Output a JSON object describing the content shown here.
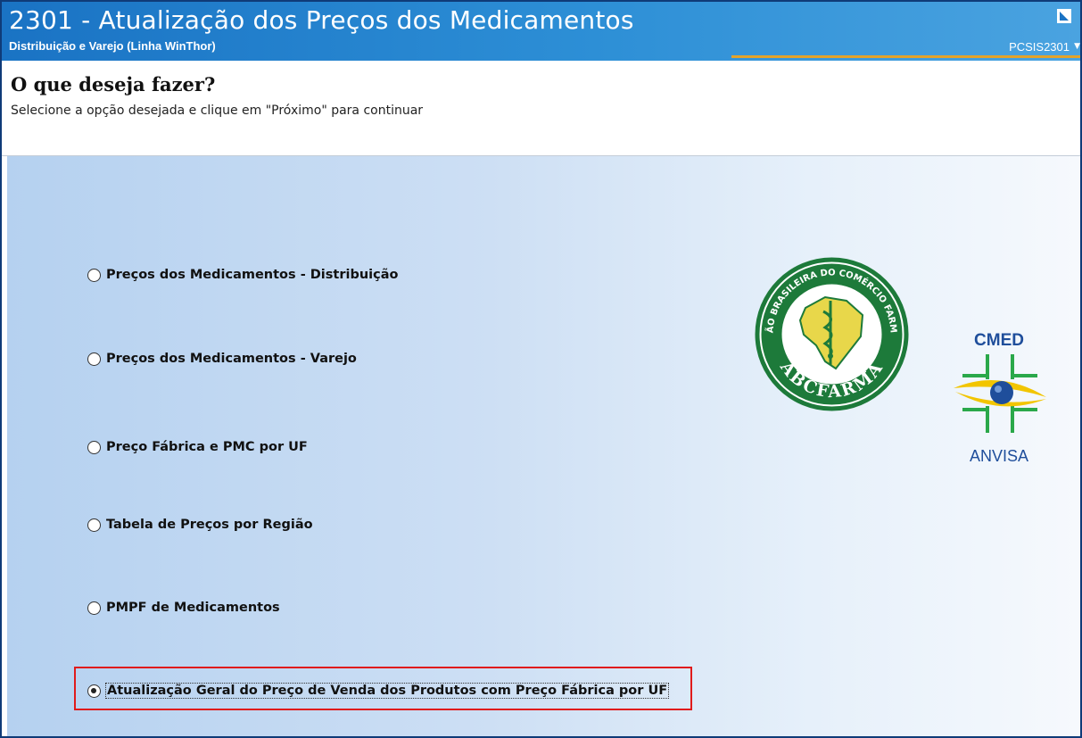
{
  "window": {
    "title": "2301 - Atualização dos Preços dos Medicamentos",
    "subtitle": "Distribuição e Varejo (Linha WinThor)",
    "code": "PCSIS2301",
    "code_arrow": "▼"
  },
  "header": {
    "heading": "O que deseja fazer?",
    "instruction": "Selecione a opção desejada e clique em \"Próximo\" para continuar"
  },
  "options": [
    {
      "label": "Preços dos Medicamentos - Distribuição",
      "checked": false
    },
    {
      "label": "Preços dos Medicamentos - Varejo",
      "checked": false
    },
    {
      "label": "Preço Fábrica e PMC por UF",
      "checked": false
    },
    {
      "label": "Tabela de Preços por Região",
      "checked": false
    },
    {
      "label": "PMPF de Medicamentos",
      "checked": false
    },
    {
      "label": "Atualização Geral do Preço de Venda dos Produtos com Preço Fábrica por UF",
      "checked": true
    }
  ],
  "logos": {
    "abcfarma": "ABCFARMA",
    "abcfarma_ring": "ASSOCIAÇÃO BRASILEIRA DO COMÉRCIO FARMACÊUTICO",
    "cmed": "CMED",
    "anvisa": "ANVISA"
  },
  "colors": {
    "titlebar": "#1a73c4",
    "highlight": "#e01b1b",
    "abcfarma_green": "#1d7a3a",
    "cmed_blue": "#1f4e9b",
    "cmed_green": "#2aa84a",
    "cmed_yellow": "#f2c500"
  }
}
